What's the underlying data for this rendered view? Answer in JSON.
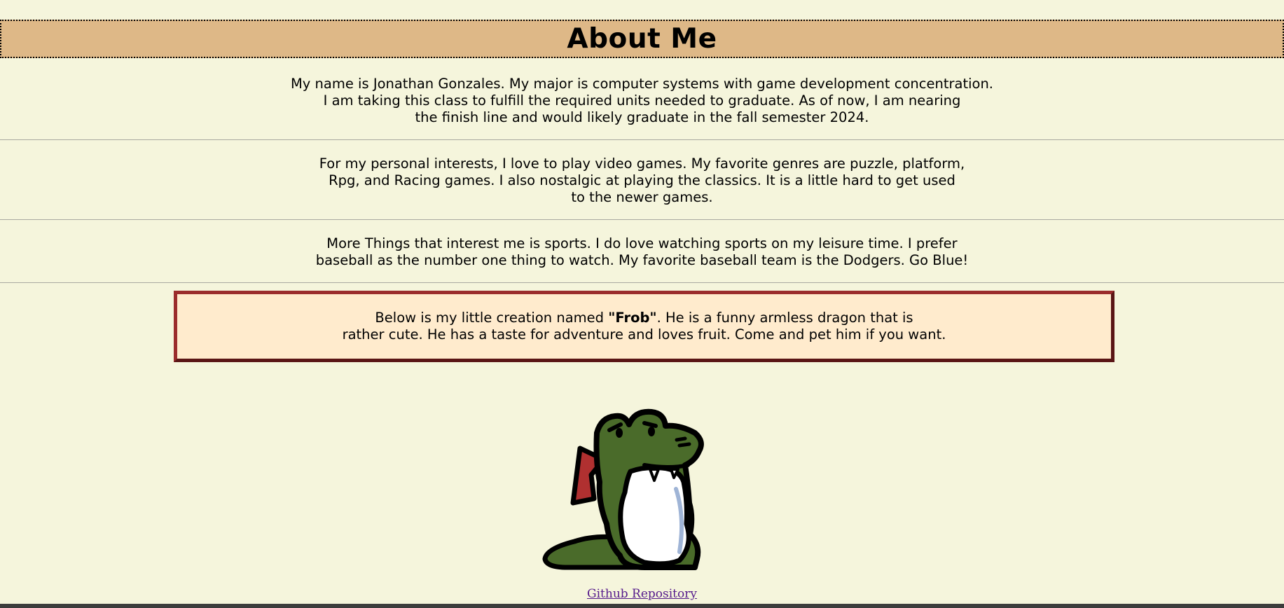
{
  "header": {
    "title": "About Me"
  },
  "intro": {
    "lines": [
      "My name is Jonathan Gonzales. My major is computer systems with game development concentration.",
      "I am taking this class to fulfill the required units needed to graduate. As of now, I am nearing",
      "the finish line and would likely graduate in the fall semester 2024."
    ]
  },
  "interests": {
    "lines": [
      "For my personal interests, I love to play video games. My favorite genres are puzzle, platform,",
      "Rpg, and Racing games. I also nostalgic at playing the classics. It is a little hard to get used",
      "to the newer games."
    ]
  },
  "sports": {
    "lines": [
      "More Things that interest me is sports. I do love watching sports on my leisure time. I prefer",
      "baseball as the number one thing to watch. My favorite baseball team is the Dodgers. Go Blue!"
    ]
  },
  "callout": {
    "before": "Below is my little creation named ",
    "name": "\"Frob\"",
    "after": ". He is a funny armless dragon that is",
    "line2": "rather cute. He has a taste for adventure and loves fruit. Come and pet him if you want."
  },
  "image": {
    "icon": "frob-dragon-image"
  },
  "footer": {
    "link_label": "Github Repository"
  },
  "colors": {
    "background": "#f5f5dc",
    "header_bg": "#deb887",
    "callout_bg": "#ffebcd",
    "callout_border": "#9b2c2c",
    "dragon_green": "#4a6b2a",
    "dragon_wing": "#b03030",
    "link": "#551a8b"
  }
}
